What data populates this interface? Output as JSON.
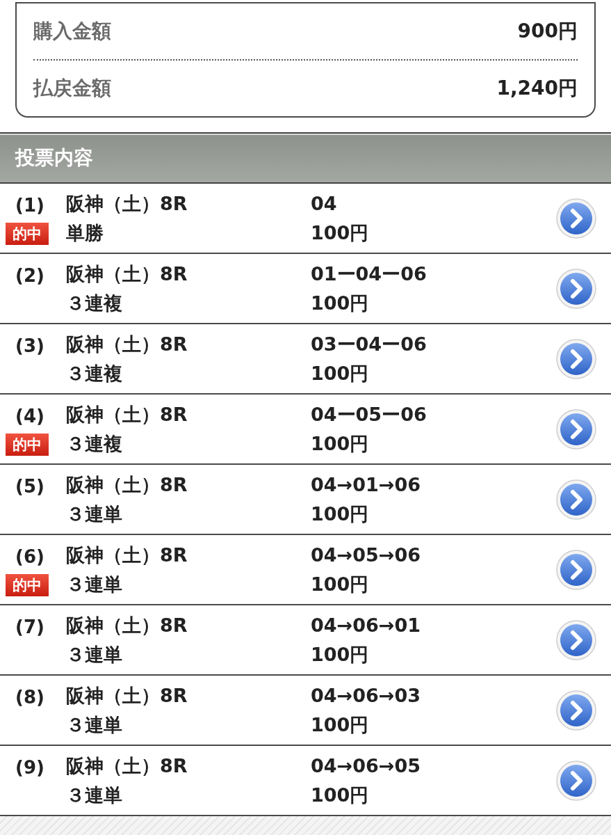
{
  "summary": [
    {
      "label": "購入金額",
      "value": "900円"
    },
    {
      "label": "払戻金額",
      "value": "1,240円"
    }
  ],
  "section_title": "投票内容",
  "bets": [
    {
      "number": "(1)",
      "badge": "的中",
      "venue": "阪神（土）8R",
      "bet_type": "単勝",
      "combination": "04",
      "amount": "100円"
    },
    {
      "number": "(2)",
      "venue": "阪神（土）8R",
      "bet_type": "３連複",
      "combination": "01ー04ー06",
      "amount": "100円"
    },
    {
      "number": "(3)",
      "venue": "阪神（土）8R",
      "bet_type": "３連複",
      "combination": "03ー04ー06",
      "amount": "100円"
    },
    {
      "number": "(4)",
      "badge": "的中",
      "venue": "阪神（土）8R",
      "bet_type": "３連複",
      "combination": "04ー05ー06",
      "amount": "100円"
    },
    {
      "number": "(5)",
      "venue": "阪神（土）8R",
      "bet_type": "３連単",
      "combination": "04→01→06",
      "amount": "100円"
    },
    {
      "number": "(6)",
      "badge": "的中",
      "venue": "阪神（土）8R",
      "bet_type": "３連単",
      "combination": "04→05→06",
      "amount": "100円"
    },
    {
      "number": "(7)",
      "venue": "阪神（土）8R",
      "bet_type": "３連単",
      "combination": "04→06→01",
      "amount": "100円"
    },
    {
      "number": "(8)",
      "venue": "阪神（土）8R",
      "bet_type": "３連単",
      "combination": "04→06→03",
      "amount": "100円"
    },
    {
      "number": "(9)",
      "venue": "阪神（土）8R",
      "bet_type": "３連単",
      "combination": "04→06→05",
      "amount": "100円"
    }
  ]
}
